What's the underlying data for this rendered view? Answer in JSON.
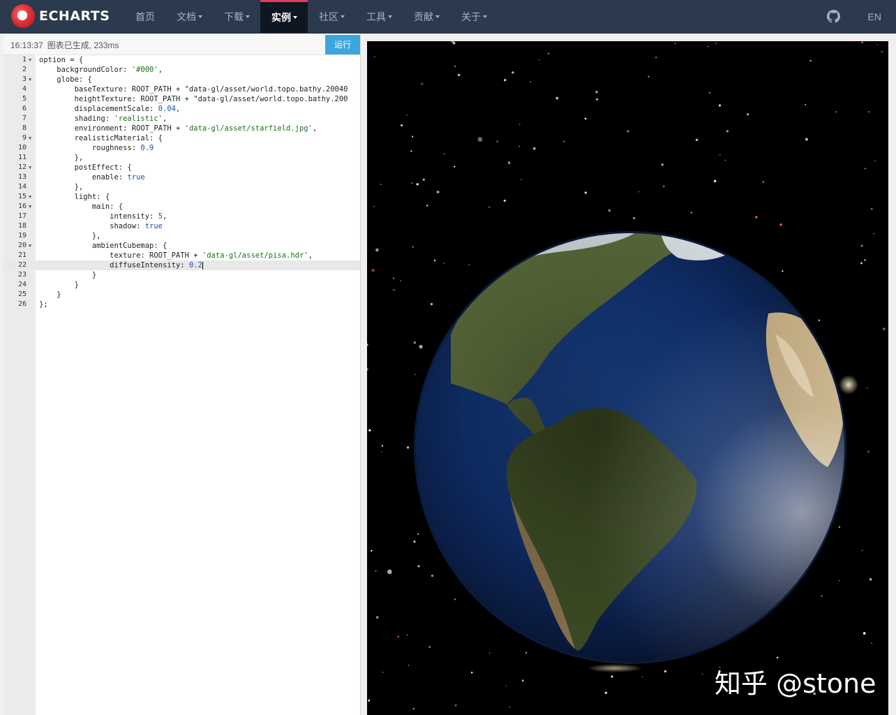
{
  "nav": {
    "logo_text": "ECHARTS",
    "items": [
      {
        "label": "首页",
        "dropdown": false
      },
      {
        "label": "文档",
        "dropdown": true
      },
      {
        "label": "下载",
        "dropdown": true
      },
      {
        "label": "实例",
        "dropdown": true,
        "active": true
      },
      {
        "label": "社区",
        "dropdown": true
      },
      {
        "label": "工具",
        "dropdown": true
      },
      {
        "label": "贡献",
        "dropdown": true
      },
      {
        "label": "关于",
        "dropdown": true
      }
    ],
    "github_icon": "github-icon",
    "lang": "EN",
    "colors": {
      "bar": "#2b3a4e",
      "active_bg": "#0e1622",
      "active_accent": "#e43c59"
    }
  },
  "editor": {
    "time": "16:13:37",
    "status_msg": "图表已生成, 233ms",
    "run_label": "运行",
    "current_line": 22,
    "lines": [
      {
        "n": "1",
        "fold": true,
        "text": "option = {"
      },
      {
        "n": "2",
        "fold": false,
        "text": "    backgroundColor: '#000',"
      },
      {
        "n": "3",
        "fold": true,
        "text": "    globe: {"
      },
      {
        "n": "4",
        "fold": false,
        "text": "        baseTexture: ROOT_PATH + \"data-gl/asset/world.topo.bathy.20040"
      },
      {
        "n": "5",
        "fold": false,
        "text": "        heightTexture: ROOT_PATH + \"data-gl/asset/world.topo.bathy.200"
      },
      {
        "n": "6",
        "fold": false,
        "text": "        displacementScale: 0.04,"
      },
      {
        "n": "7",
        "fold": false,
        "text": "        shading: 'realistic',"
      },
      {
        "n": "8",
        "fold": false,
        "text": "        environment: ROOT_PATH + 'data-gl/asset/starfield.jpg',"
      },
      {
        "n": "9",
        "fold": true,
        "text": "        realisticMaterial: {"
      },
      {
        "n": "10",
        "fold": false,
        "text": "            roughness: 0.9"
      },
      {
        "n": "11",
        "fold": false,
        "text": "        },"
      },
      {
        "n": "12",
        "fold": true,
        "text": "        postEffect: {"
      },
      {
        "n": "13",
        "fold": false,
        "text": "            enable: true"
      },
      {
        "n": "14",
        "fold": false,
        "text": "        },"
      },
      {
        "n": "15",
        "fold": true,
        "text": "        light: {"
      },
      {
        "n": "16",
        "fold": true,
        "text": "            main: {"
      },
      {
        "n": "17",
        "fold": false,
        "text": "                intensity: 5,"
      },
      {
        "n": "18",
        "fold": false,
        "text": "                shadow: true"
      },
      {
        "n": "19",
        "fold": false,
        "text": "            },"
      },
      {
        "n": "20",
        "fold": true,
        "text": "            ambientCubemap: {"
      },
      {
        "n": "21",
        "fold": false,
        "text": "                texture: ROOT_PATH + 'data-gl/asset/pisa.hdr',"
      },
      {
        "n": "22",
        "fold": false,
        "text": "                diffuseIntensity: 0.2"
      },
      {
        "n": "23",
        "fold": false,
        "text": "            }"
      },
      {
        "n": "24",
        "fold": false,
        "text": "        }"
      },
      {
        "n": "25",
        "fold": false,
        "text": "    }"
      },
      {
        "n": "26",
        "fold": false,
        "text": "};"
      }
    ]
  },
  "chart": {
    "background": "#000",
    "subject": "globe"
  },
  "watermark": "知乎 @stone"
}
